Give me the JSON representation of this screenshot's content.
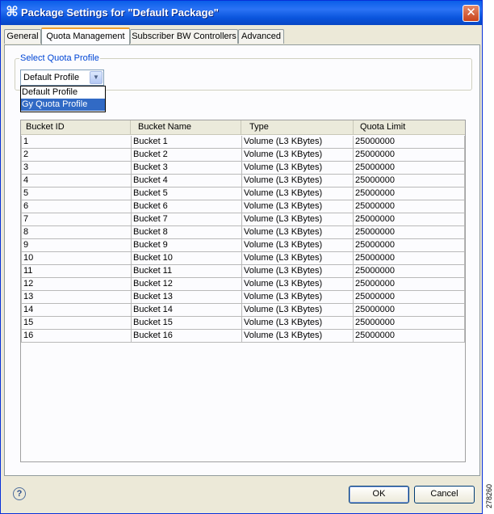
{
  "window": {
    "title": "Package Settings for \"Default Package\"",
    "close_symbol": "✕",
    "icon": "cisco-command-icon"
  },
  "tabs": [
    {
      "label": "General",
      "active": false
    },
    {
      "label": "Quota Management",
      "active": true
    },
    {
      "label": "Subscriber BW Controllers",
      "active": false
    },
    {
      "label": "Advanced",
      "active": false
    }
  ],
  "quota_profile": {
    "group_label": "Select Quota Profile",
    "selected": "Default Profile",
    "options": [
      "Default Profile",
      "Gy Quota Profile"
    ],
    "highlighted_option": "Gy Quota Profile"
  },
  "table": {
    "columns": [
      "Bucket ID",
      "Bucket Name",
      "Type",
      "Quota Limit"
    ],
    "rows": [
      [
        "1",
        "Bucket 1",
        "Volume (L3 KBytes)",
        "25000000"
      ],
      [
        "2",
        "Bucket 2",
        "Volume (L3 KBytes)",
        "25000000"
      ],
      [
        "3",
        "Bucket 3",
        "Volume (L3 KBytes)",
        "25000000"
      ],
      [
        "4",
        "Bucket 4",
        "Volume (L3 KBytes)",
        "25000000"
      ],
      [
        "5",
        "Bucket 5",
        "Volume (L3 KBytes)",
        "25000000"
      ],
      [
        "6",
        "Bucket 6",
        "Volume (L3 KBytes)",
        "25000000"
      ],
      [
        "7",
        "Bucket 7",
        "Volume (L3 KBytes)",
        "25000000"
      ],
      [
        "8",
        "Bucket 8",
        "Volume (L3 KBytes)",
        "25000000"
      ],
      [
        "9",
        "Bucket 9",
        "Volume (L3 KBytes)",
        "25000000"
      ],
      [
        "10",
        "Bucket 10",
        "Volume (L3 KBytes)",
        "25000000"
      ],
      [
        "11",
        "Bucket 11",
        "Volume (L3 KBytes)",
        "25000000"
      ],
      [
        "12",
        "Bucket 12",
        "Volume (L3 KBytes)",
        "25000000"
      ],
      [
        "13",
        "Bucket 13",
        "Volume (L3 KBytes)",
        "25000000"
      ],
      [
        "14",
        "Bucket 14",
        "Volume (L3 KBytes)",
        "25000000"
      ],
      [
        "15",
        "Bucket 15",
        "Volume (L3 KBytes)",
        "25000000"
      ],
      [
        "16",
        "Bucket 16",
        "Volume (L3 KBytes)",
        "25000000"
      ]
    ]
  },
  "footer": {
    "help_symbol": "?",
    "ok_label": "OK",
    "cancel_label": "Cancel"
  },
  "figure_id": "278260"
}
